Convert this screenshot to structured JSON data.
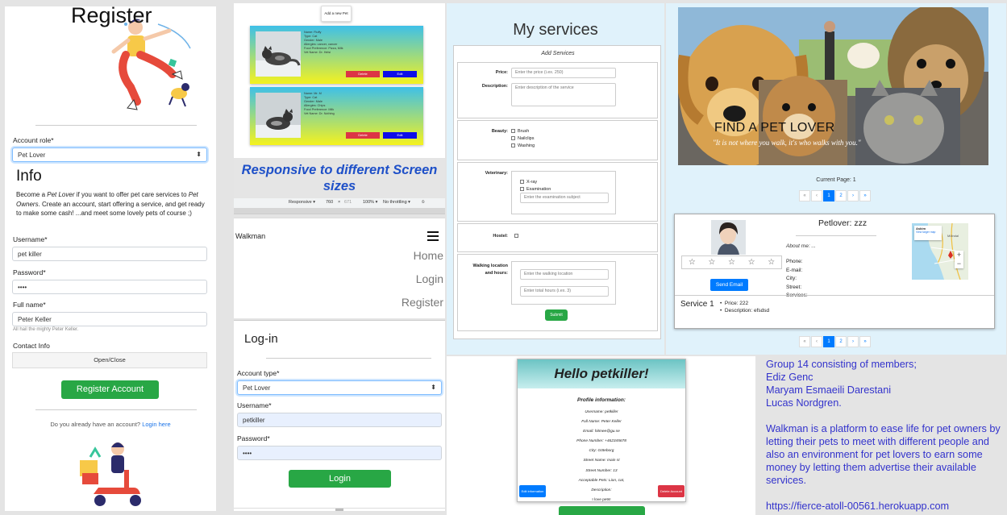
{
  "register": {
    "title": "Register",
    "account_role_label": "Account role*",
    "account_role_value": "Pet Lover",
    "info_heading": "Info",
    "info_pre": "Become a ",
    "info_role": "Pet Lover",
    "info_mid": " if you want to offer pet care services to ",
    "info_owners": "Pet Owners",
    "info_post": ". Create an account, start offering a service, and get ready to make some cash! ...and meet some lovely pets of course ;)",
    "username_label": "Username*",
    "username_value": "pet killer",
    "password_label": "Password*",
    "password_value": "••••",
    "fullname_label": "Full name*",
    "fullname_value": "Peter Keller",
    "fullname_hint": "All hail the mighty Peter Keller.",
    "contact_label": "Contact Info",
    "toggle_label": "Open/Close",
    "register_button": "Register Account",
    "login_question": "Do you already have an account?",
    "login_link": "Login here"
  },
  "pets": {
    "add_button": "Add a new Pet",
    "cards": [
      {
        "lines": [
          "Name: Fluffy",
          "Type: Cat",
          "Gender: Male",
          "Allergies: cancer, cancer",
          "Food Preference: Pizza, Milk",
          "Vet Name: Dr. Helsi"
        ],
        "delete": "Delete",
        "edit": "Edit"
      },
      {
        "lines": [
          "Name: Mr. M",
          "Type: Cat",
          "Gender: Male",
          "Allergies: Chips",
          "Food Preference: Milk",
          "Vet Name: Dr. Nothing"
        ],
        "delete": "Delete",
        "edit": "Edit"
      }
    ]
  },
  "banner": {
    "line1": "Responsive to different Screen",
    "line2": "sizes"
  },
  "devtools": {
    "device": "Responsive ▾",
    "width": "760",
    "x": "×",
    "height": "671",
    "zoom": "100% ▾",
    "throttle": "No throttling ▾"
  },
  "mobile_nav": {
    "brand": "Walkman",
    "links": [
      "Home",
      "Login",
      "Register"
    ]
  },
  "login": {
    "title": "Log-in",
    "account_type_label": "Account type*",
    "account_type_value": "Pet Lover",
    "username_label": "Username*",
    "username_value": "petkiller",
    "password_label": "Password*",
    "password_value": "••••",
    "login_button": "Login"
  },
  "services": {
    "title": "My services",
    "subtitle": "Add Services",
    "price_label": "Price:",
    "price_placeholder": "Enter the price (i.ex. 250)",
    "desc_label": "Description:",
    "desc_placeholder": "Enter description of the service",
    "beauty_label": "Beauty:",
    "beauty_options": [
      "Brush",
      "Nailclips",
      "Washing"
    ],
    "vet_label": "Veterinary:",
    "vet_options": [
      "X-ray",
      "Examination"
    ],
    "vet_placeholder": "Enter the examination subject",
    "hostel_label": "Hostel:",
    "walk_label_1": "Walking location",
    "walk_label_2": "and hours:",
    "walk_location_placeholder": "Enter the walking location",
    "walk_hours_placeholder": "Enter total hours (i.ex. 3)",
    "submit": "Submit"
  },
  "petlover": {
    "hero_title": "FIND A PET LOVER",
    "hero_quote": "\"It is not where you walk, it's who walks with you.\"",
    "current_page": "Current Page: 1",
    "pagination": [
      "«",
      "‹",
      "1",
      "2",
      "›",
      "»"
    ],
    "name": "Petlover: zzz",
    "about": "About me: ...",
    "contact_fields": [
      "Phone:",
      "E-mail:",
      "City:",
      "Street:",
      "Services:"
    ],
    "stars": [
      "☆",
      "☆",
      "☆",
      "☆",
      "☆"
    ],
    "rating": 0,
    "send_email": "Send Email",
    "map_place": "Askim",
    "map_link": "View larger map",
    "map_city": "Mölndal",
    "map_plus": "+",
    "map_minus": "−",
    "service_title": "Service 1",
    "service_price": "Price: 222",
    "service_desc": "Description: efsdsd"
  },
  "profile": {
    "greeting": "Hello petkiller!",
    "section_title": "Profile information:",
    "rows": [
      "Username: petkiller",
      "Full Name: Peter Keller",
      "Email: hitmee@gu.se",
      "Phone Number: +462345678",
      "City: Göteborg",
      "Street Name: main st",
      "Street Number: 13",
      "Acceptable Pets: Lion, cat,",
      "Description:",
      "I love pets!"
    ],
    "edit_button": "Edit information",
    "delete_button": "Delete Account"
  },
  "about": {
    "lines": [
      "Group 14 consisting of members;",
      "Ediz Genc",
      "Maryam Esmaeili Darestani",
      "Lucas Nordgren.",
      "",
      "Walkman is a platform to ease life for pet owners by letting their pets to meet with different people and also an environment for pet lovers to earn some money by letting them advertise their available services.",
      "",
      "https://fierce-atoll-00561.herokuapp.com"
    ]
  }
}
